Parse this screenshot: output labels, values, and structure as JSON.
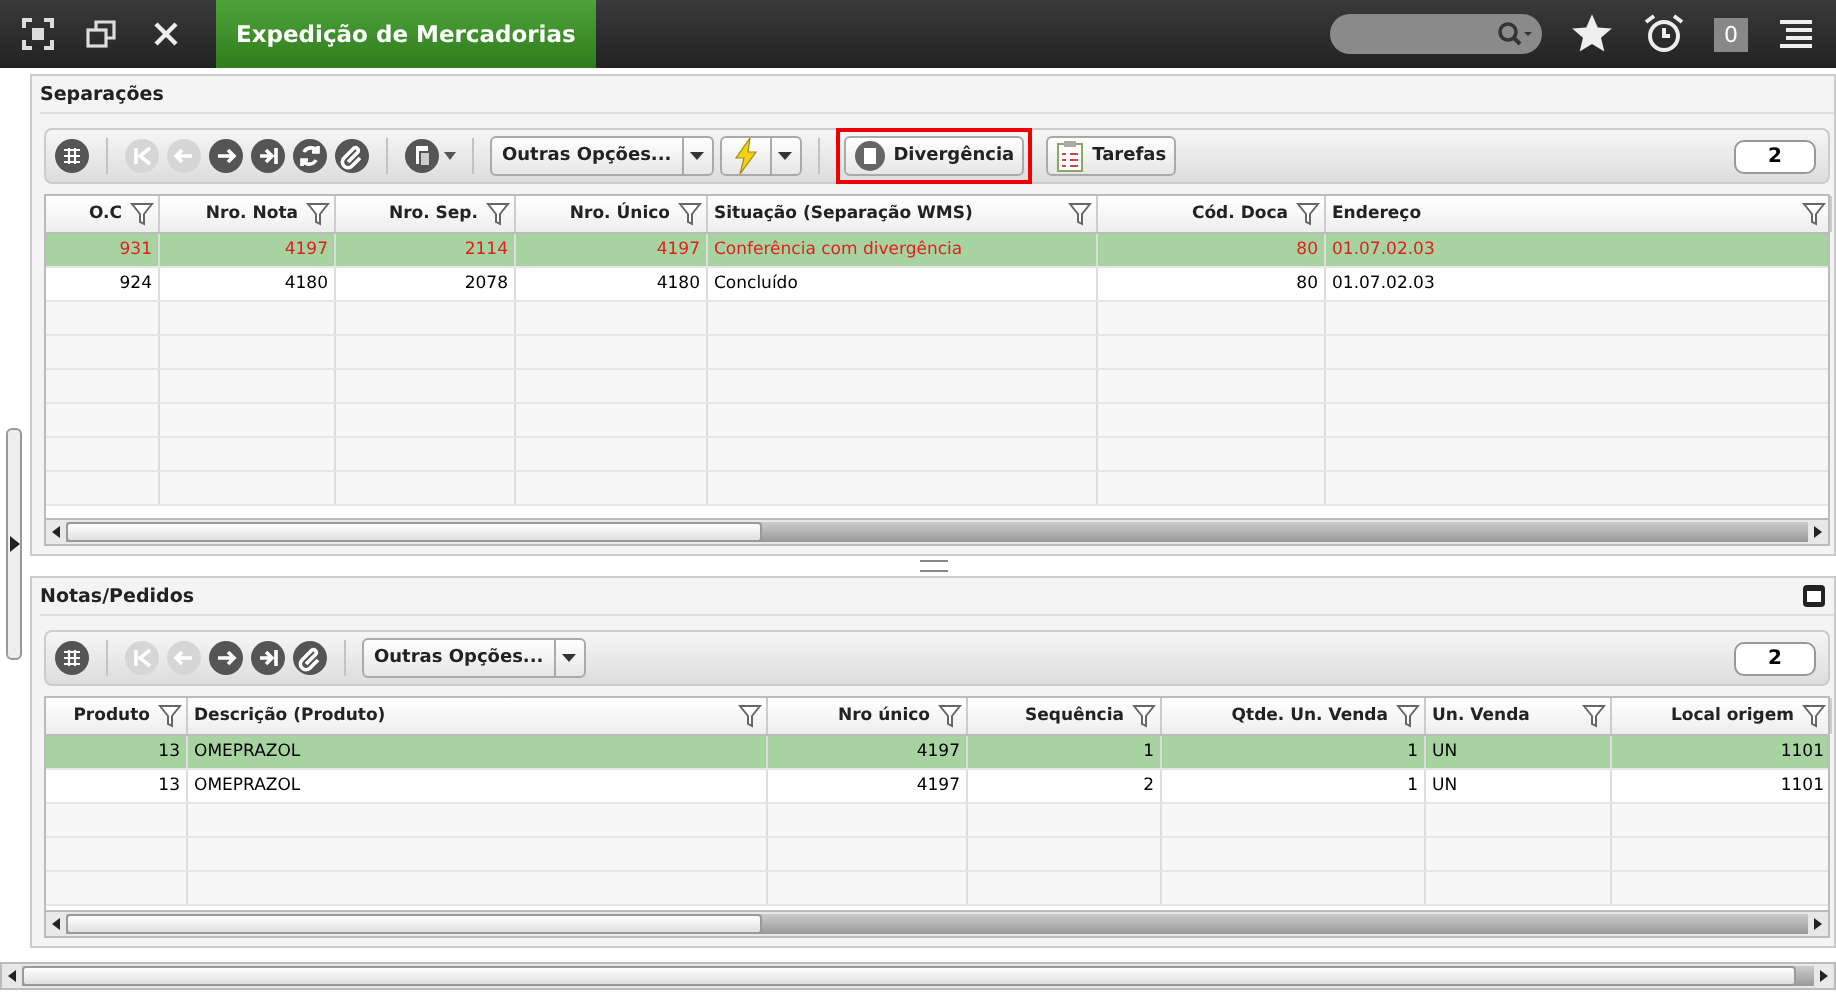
{
  "top_bar": {
    "title": "Expedição de Mercadorias",
    "notification_count": "0"
  },
  "panels": [
    {
      "title": "Separações",
      "collapse_button": false,
      "nav_buttons": [
        {
          "disabled": true
        },
        {
          "disabled": true
        },
        {
          "disabled": false
        },
        {
          "disabled": false
        },
        {
          "disabled": false
        },
        {
          "disabled": false
        }
      ],
      "extra_menu": true,
      "options_label": "Outras Opções...",
      "action_menu": true,
      "actions": [
        {
          "label": "Divergência",
          "highlighted": true
        },
        {
          "label": "Tarefas",
          "highlighted": false
        }
      ],
      "count": "2",
      "columns": [
        {
          "label": "O.C",
          "kind": "number"
        },
        {
          "label": "Nro. Nota",
          "kind": "number"
        },
        {
          "label": "Nro. Sep.",
          "kind": "number"
        },
        {
          "label": "Nro. Único",
          "kind": "number"
        },
        {
          "label": "Situação (Separação WMS)",
          "kind": "text"
        },
        {
          "label": "Cód. Doca",
          "kind": "number"
        },
        {
          "label": "Endereço",
          "kind": "text"
        }
      ],
      "rows": [
        {
          "selected": true,
          "alert": true,
          "cells": [
            "931",
            "4197",
            "2114",
            "4197",
            "Conferência com divergência",
            "80",
            "01.07.02.03"
          ]
        },
        {
          "selected": false,
          "alert": false,
          "cells": [
            "924",
            "4180",
            "2078",
            "4180",
            "Concluído",
            "80",
            "01.07.02.03"
          ]
        }
      ]
    },
    {
      "title": "Notas/Pedidos",
      "collapse_button": true,
      "nav_buttons": [
        {
          "disabled": true
        },
        {
          "disabled": true
        },
        {
          "disabled": false
        },
        {
          "disabled": false
        },
        {
          "disabled": false
        }
      ],
      "extra_menu": false,
      "options_label": "Outras Opções...",
      "action_menu": false,
      "count": "2",
      "columns": [
        {
          "label": "Produto",
          "kind": "number"
        },
        {
          "label": "Descrição (Produto)",
          "kind": "text"
        },
        {
          "label": "Nro único",
          "kind": "number"
        },
        {
          "label": "Sequência",
          "kind": "number"
        },
        {
          "label": "Qtde. Un. Venda",
          "kind": "number"
        },
        {
          "label": "Un. Venda",
          "kind": "text"
        },
        {
          "label": "Local origem",
          "kind": "number"
        }
      ],
      "rows": [
        {
          "selected": true,
          "alert": false,
          "cells": [
            "13",
            "OMEPRAZOL",
            "4197",
            "1",
            "1",
            "UN",
            "1101"
          ]
        },
        {
          "selected": false,
          "alert": false,
          "cells": [
            "13",
            "OMEPRAZOL",
            "4197",
            "2",
            "1",
            "UN",
            "1101"
          ]
        }
      ]
    }
  ]
}
